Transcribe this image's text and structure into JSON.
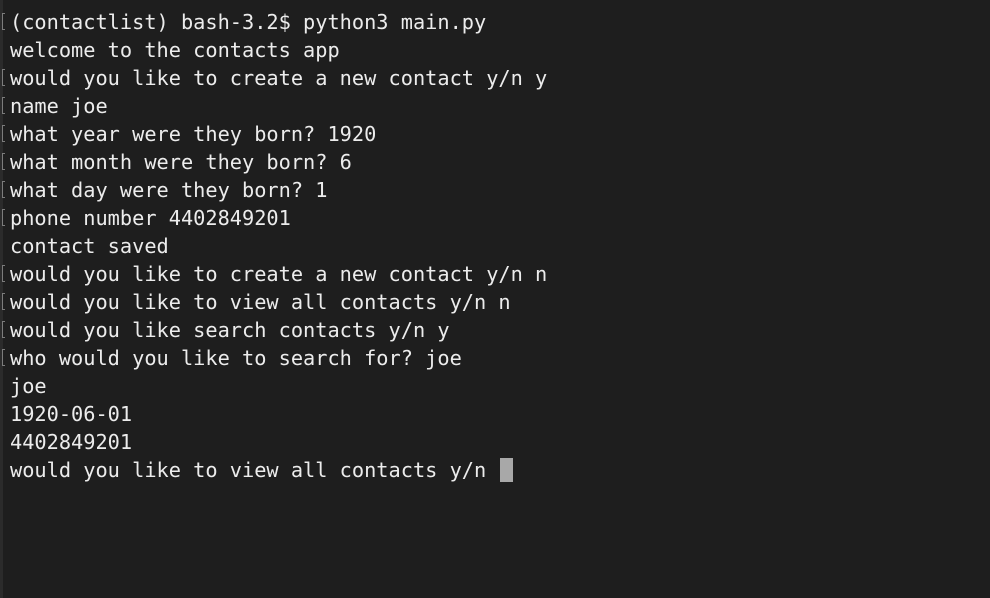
{
  "terminal": {
    "lines": [
      {
        "text": "(contactlist) bash-3.2$ python3 main.py",
        "marker": true
      },
      {
        "text": "welcome to the contacts app",
        "marker": false
      },
      {
        "text": "would you like to create a new contact y/n y",
        "marker": true
      },
      {
        "text": "name joe",
        "marker": true
      },
      {
        "text": "what year were they born? 1920",
        "marker": true
      },
      {
        "text": "what month were they born? 6",
        "marker": true
      },
      {
        "text": "what day were they born? 1",
        "marker": true
      },
      {
        "text": "phone number 4402849201",
        "marker": true
      },
      {
        "text": "contact saved",
        "marker": false
      },
      {
        "text": "would you like to create a new contact y/n n",
        "marker": true
      },
      {
        "text": "would you like to view all contacts y/n n",
        "marker": true
      },
      {
        "text": "would you like search contacts y/n y",
        "marker": true
      },
      {
        "text": "who would you like to search for? joe",
        "marker": true
      },
      {
        "text": "joe",
        "marker": false
      },
      {
        "text": "1920-06-01",
        "marker": false
      },
      {
        "text": "4402849201",
        "marker": false
      }
    ],
    "prompt_line": "would you like to view all contacts y/n ",
    "colors": {
      "background": "#1e1e1e",
      "foreground": "#ececec",
      "cursor": "#a8a8a8",
      "marker": "#7c7c7c"
    }
  }
}
